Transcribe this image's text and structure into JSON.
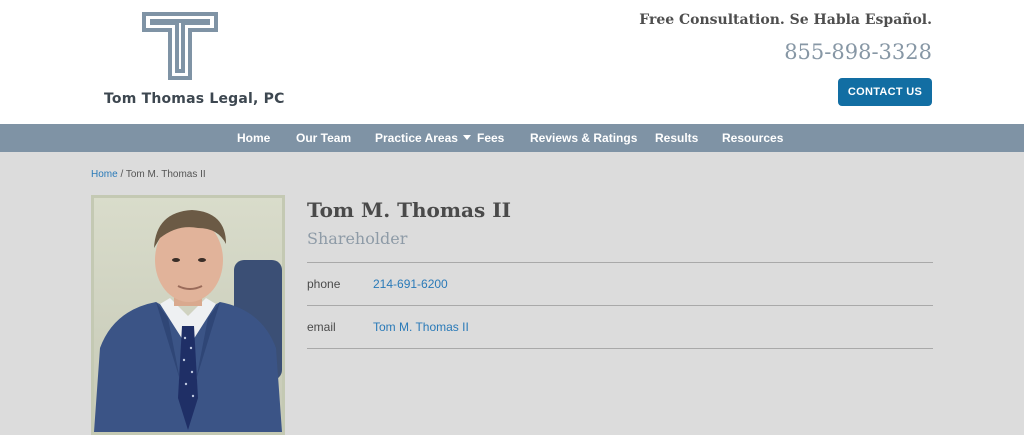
{
  "brand": {
    "name": "Tom Thomas Legal, PC",
    "tagline": "Free Consultation. Se Habla Español.",
    "phone": "855-898-3328",
    "contact_label": "CONTACT US"
  },
  "nav": {
    "items": [
      {
        "label": "Home"
      },
      {
        "label": "Our Team"
      },
      {
        "label": "Practice Areas",
        "has_dropdown": true
      },
      {
        "label": "Fees"
      },
      {
        "label": "Reviews & Ratings"
      },
      {
        "label": "Results"
      },
      {
        "label": "Resources"
      }
    ]
  },
  "breadcrumb": {
    "home": "Home",
    "separator": "/",
    "current": "Tom M. Thomas II"
  },
  "profile": {
    "name": "Tom M. Thomas II",
    "title": "Shareholder",
    "phone_label": "phone",
    "phone_value": "214-691-6200",
    "email_label": "email",
    "email_value": "Tom M. Thomas II"
  },
  "colors": {
    "nav_bg": "#7f93a5",
    "button_bg": "#126ea3",
    "link": "#2a7ab8",
    "page_bg": "#dcdcdc"
  }
}
